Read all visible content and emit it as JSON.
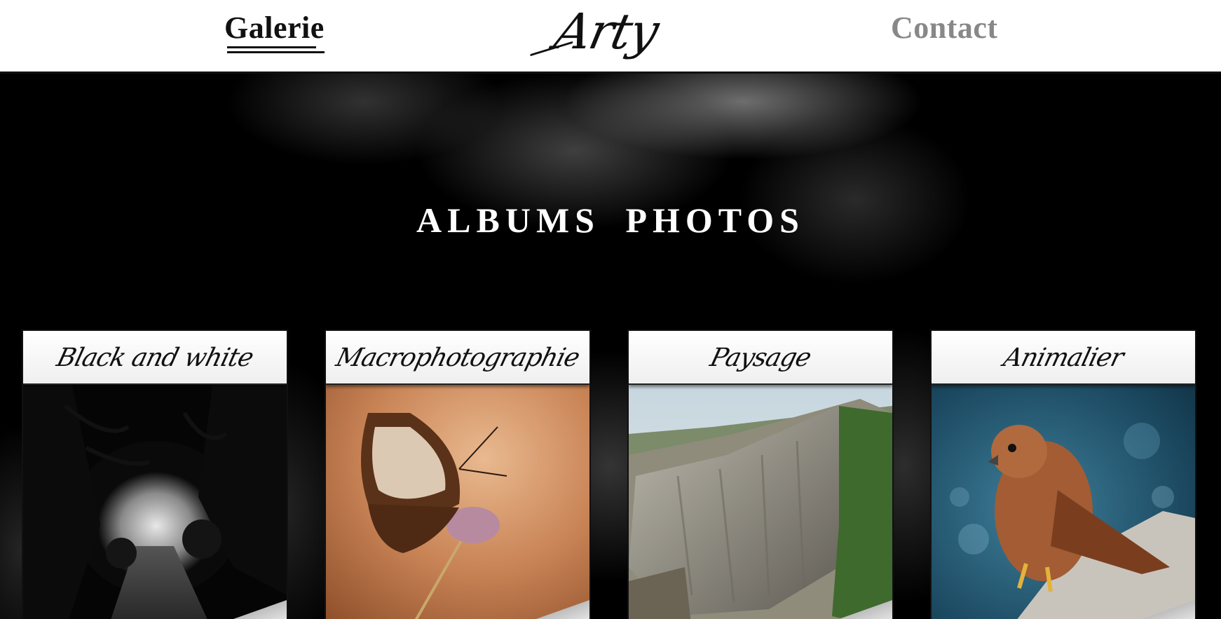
{
  "nav": {
    "links": [
      {
        "label": "Galerie",
        "active": true
      },
      {
        "label": "Contact",
        "active": false
      }
    ],
    "logo_text": "Arty"
  },
  "hero": {
    "title": "ALBUMS PHOTOS"
  },
  "albums": [
    {
      "title": "Black and white",
      "photo": "forest-path-bw-photo"
    },
    {
      "title": "Macrophotographie",
      "photo": "butterfly-on-flower-photo"
    },
    {
      "title": "Paysage",
      "photo": "mountain-cliff-photo"
    },
    {
      "title": "Animalier",
      "photo": "kestrel-bird-photo"
    }
  ],
  "colors": {
    "nav_bg": "#ffffff",
    "nav_active": "#111111",
    "nav_inactive": "#888888",
    "page_bg": "#000000",
    "hero_title": "#ffffff"
  }
}
